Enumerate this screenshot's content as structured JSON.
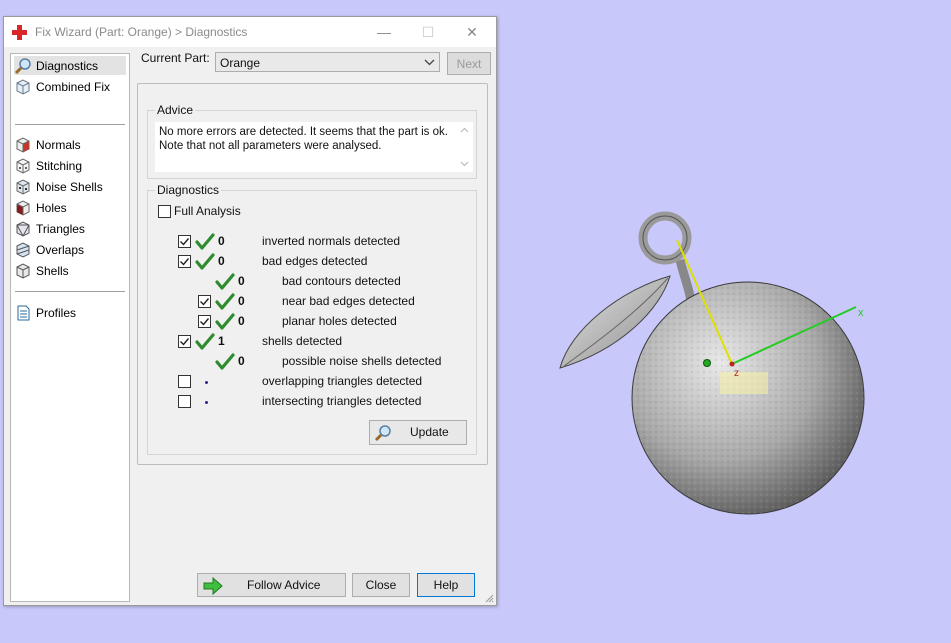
{
  "window": {
    "title": "Fix Wizard (Part: Orange) > Diagnostics",
    "controls": {
      "minimize": "—",
      "maximize": "☐",
      "close": "✕"
    }
  },
  "sidebar": {
    "items": [
      {
        "label": "Diagnostics",
        "icon": "magnifier-icon",
        "selected": true
      },
      {
        "label": "Combined Fix",
        "icon": "cube-icon"
      },
      {
        "label": "Normals",
        "icon": "normals-cube-icon"
      },
      {
        "label": "Stitching",
        "icon": "stitching-cube-icon"
      },
      {
        "label": "Noise Shells",
        "icon": "noise-shells-icon"
      },
      {
        "label": "Holes",
        "icon": "holes-cube-icon"
      },
      {
        "label": "Triangles",
        "icon": "triangles-icon"
      },
      {
        "label": "Overlaps",
        "icon": "overlaps-icon"
      },
      {
        "label": "Shells",
        "icon": "shells-icon"
      },
      {
        "label": "Profiles",
        "icon": "document-icon"
      }
    ]
  },
  "header": {
    "current_part_label": "Current Part:",
    "current_part_value": "Orange",
    "next_label": "Next"
  },
  "advice": {
    "title": "Advice",
    "line1": "No more errors are detected. It seems that the part is ok.",
    "line2": "Note that not all parameters were analysed."
  },
  "diagnostics": {
    "title": "Diagnostics",
    "full_analysis_label": "Full Analysis",
    "full_analysis_checked": false,
    "rows": [
      {
        "checkbox": true,
        "checked": true,
        "status": "ok",
        "count": "0",
        "text": "inverted normals detected",
        "indent": false
      },
      {
        "checkbox": true,
        "checked": true,
        "status": "ok",
        "count": "0",
        "text": "bad edges detected",
        "indent": false
      },
      {
        "checkbox": false,
        "checked": false,
        "status": "ok",
        "count": "0",
        "text": "bad contours detected",
        "indent": true
      },
      {
        "checkbox": true,
        "checked": true,
        "status": "ok",
        "count": "0",
        "text": "near bad edges detected",
        "indent": true
      },
      {
        "checkbox": true,
        "checked": true,
        "status": "ok",
        "count": "0",
        "text": "planar holes detected",
        "indent": true
      },
      {
        "checkbox": true,
        "checked": true,
        "status": "ok",
        "count": "1",
        "text": "shells detected",
        "indent": false
      },
      {
        "checkbox": false,
        "checked": false,
        "status": "ok",
        "count": "0",
        "text": "possible noise shells detected",
        "indent": true
      },
      {
        "checkbox": true,
        "checked": false,
        "status": "dot",
        "count": "",
        "text": "overlapping triangles detected",
        "indent": false
      },
      {
        "checkbox": true,
        "checked": false,
        "status": "dot",
        "count": "",
        "text": "intersecting triangles detected",
        "indent": false
      }
    ],
    "update_label": "Update"
  },
  "footer": {
    "follow_advice_label": "Follow Advice",
    "close_label": "Close",
    "help_label": "Help"
  },
  "viewport": {
    "object": "orange-3d-model",
    "axes": {
      "x": "x",
      "z": "z"
    },
    "colors": {
      "background": "#c8c8fa",
      "x_axis": "#22cc22",
      "z_axis": "#e0e000"
    }
  }
}
